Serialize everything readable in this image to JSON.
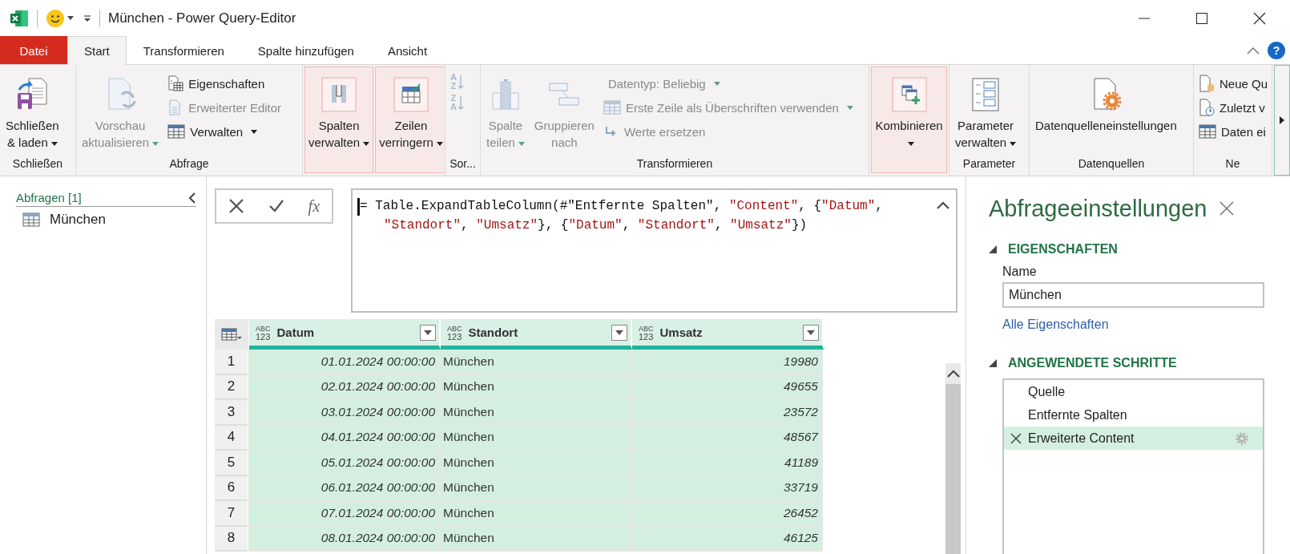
{
  "window": {
    "title": "München - Power Query-Editor"
  },
  "tabs": [
    {
      "label": "Datei",
      "kind": "file",
      "selected": false
    },
    {
      "label": "Start",
      "kind": "tab",
      "selected": true
    },
    {
      "label": "Transformieren",
      "kind": "tab",
      "selected": false
    },
    {
      "label": "Spalte hinzufügen",
      "kind": "tab",
      "selected": false
    },
    {
      "label": "Ansicht",
      "kind": "tab",
      "selected": false
    }
  ],
  "help_label": "?",
  "ribbon": {
    "groups": [
      {
        "label": "Schließen",
        "items": [
          {
            "kind": "large",
            "lines": [
              "Schließen",
              "& laden"
            ],
            "dropdown": true,
            "disabled": false,
            "highlighted": false
          }
        ]
      },
      {
        "label": "Abfrage",
        "items": [
          {
            "kind": "large",
            "lines": [
              "Vorschau",
              "aktualisieren"
            ],
            "dropdown": true,
            "disabled": true,
            "highlighted": false
          },
          {
            "kind": "small",
            "label": "Eigenschaften",
            "dropdown": false,
            "disabled": false
          },
          {
            "kind": "small",
            "label": "Erweiterter Editor",
            "dropdown": false,
            "disabled": true
          },
          {
            "kind": "small",
            "label": "Verwalten",
            "dropdown": true,
            "disabled": false
          }
        ]
      },
      {
        "items": [
          {
            "kind": "large",
            "lines": [
              "Spalten",
              "verwalten"
            ],
            "dropdown": true,
            "disabled": false,
            "highlighted": true
          },
          {
            "kind": "large",
            "lines": [
              "Zeilen",
              "verringern"
            ],
            "dropdown": true,
            "disabled": false,
            "highlighted": true
          }
        ]
      },
      {
        "label": "Sor...",
        "items": [
          {
            "kind": "sort",
            "letters": [
              "A",
              "Z"
            ],
            "disabled": true
          },
          {
            "kind": "sort",
            "letters": [
              "Z",
              "A"
            ],
            "disabled": true
          }
        ]
      },
      {
        "label": "Transformieren",
        "items": [
          {
            "kind": "large",
            "lines": [
              "Spalte",
              "teilen"
            ],
            "dropdown": true,
            "disabled": true,
            "highlighted": false
          },
          {
            "kind": "large",
            "lines": [
              "Gruppieren",
              "nach"
            ],
            "dropdown": false,
            "disabled": true,
            "highlighted": false
          },
          {
            "kind": "small",
            "label": "Datentyp: Beliebig",
            "dropdown": true,
            "disabled": true
          },
          {
            "kind": "small",
            "label": "Erste Zeile als Überschriften verwenden",
            "dropdown": true,
            "disabled": true
          },
          {
            "kind": "small",
            "label": "Werte ersetzen",
            "dropdown": false,
            "disabled": true
          }
        ]
      },
      {
        "items": [
          {
            "kind": "large",
            "lines": [
              "Kombinieren"
            ],
            "dropdown": true,
            "disabled": false,
            "highlighted": true
          }
        ]
      },
      {
        "label": "Parameter",
        "items": [
          {
            "kind": "large",
            "lines": [
              "Parameter",
              "verwalten"
            ],
            "dropdown": true,
            "disabled": false,
            "highlighted": false
          }
        ]
      },
      {
        "label": "Datenquellen",
        "items": [
          {
            "kind": "large",
            "lines": [
              "Datenquelleneinstellungen"
            ],
            "dropdown": false,
            "disabled": false,
            "highlighted": false
          }
        ]
      },
      {
        "label": "Ne",
        "items": [
          {
            "kind": "small",
            "label": "Neue Qu",
            "dropdown": false,
            "disabled": false
          },
          {
            "kind": "small",
            "label": "Zuletzt v",
            "dropdown": false,
            "disabled": false
          },
          {
            "kind": "small",
            "label": "Daten ei",
            "dropdown": false,
            "disabled": false
          }
        ]
      }
    ]
  },
  "queries": {
    "title": "Abfragen [1]",
    "items": [
      {
        "label": "München"
      }
    ]
  },
  "formula_bar": {
    "function_label": "fx",
    "tokens": [
      {
        "kind": "code",
        "text": "= Table.ExpandTableColumn(#\"Entfernte Spalten\", "
      },
      {
        "kind": "string",
        "text": "\"Content\""
      },
      {
        "kind": "code",
        "text": ", {"
      },
      {
        "kind": "string",
        "text": "\"Datum\""
      },
      {
        "kind": "code",
        "text": ", "
      },
      {
        "kind": "string",
        "text": "\"Standort\""
      },
      {
        "kind": "code",
        "text": ", "
      },
      {
        "kind": "string",
        "text": "\"Umsatz\""
      },
      {
        "kind": "code",
        "text": "}, {"
      },
      {
        "kind": "string",
        "text": "\"Datum\""
      },
      {
        "kind": "code",
        "text": ", "
      },
      {
        "kind": "string",
        "text": "\"Standort\""
      },
      {
        "kind": "code",
        "text": ", "
      },
      {
        "kind": "string",
        "text": "\"Umsatz\""
      },
      {
        "kind": "code",
        "text": "})"
      }
    ]
  },
  "table": {
    "columns": [
      {
        "name": "Datum",
        "type": [
          "ABC",
          "123"
        ],
        "kind": "number"
      },
      {
        "name": "Standort",
        "type": [
          "ABC",
          "123"
        ],
        "kind": "text"
      },
      {
        "name": "Umsatz",
        "type": [
          "ABC",
          "123"
        ],
        "kind": "number"
      }
    ],
    "rows": [
      {
        "index": "1",
        "cells": [
          "01.01.2024 00:00:00",
          "München",
          "19980"
        ]
      },
      {
        "index": "2",
        "cells": [
          "02.01.2024 00:00:00",
          "München",
          "49655"
        ]
      },
      {
        "index": "3",
        "cells": [
          "03.01.2024 00:00:00",
          "München",
          "23572"
        ]
      },
      {
        "index": "4",
        "cells": [
          "04.01.2024 00:00:00",
          "München",
          "48567"
        ]
      },
      {
        "index": "5",
        "cells": [
          "05.01.2024 00:00:00",
          "München",
          "41189"
        ]
      },
      {
        "index": "6",
        "cells": [
          "06.01.2024 00:00:00",
          "München",
          "33719"
        ]
      },
      {
        "index": "7",
        "cells": [
          "07.01.2024 00:00:00",
          "München",
          "26452"
        ]
      },
      {
        "index": "8",
        "cells": [
          "08.01.2024 00:00:00",
          "München",
          "46125"
        ]
      }
    ]
  },
  "settings": {
    "title": "Abfrageeinstellungen",
    "properties": {
      "heading": "EIGENSCHAFTEN",
      "name_label": "Name",
      "name_value": "München",
      "link": "Alle Eigenschaften"
    },
    "steps": {
      "heading": "ANGEWENDETE SCHRITTE",
      "items": [
        {
          "label": "Quelle",
          "selected": false
        },
        {
          "label": "Entfernte Spalten",
          "selected": false
        },
        {
          "label": "Erweiterte Content",
          "selected": true
        }
      ]
    }
  }
}
